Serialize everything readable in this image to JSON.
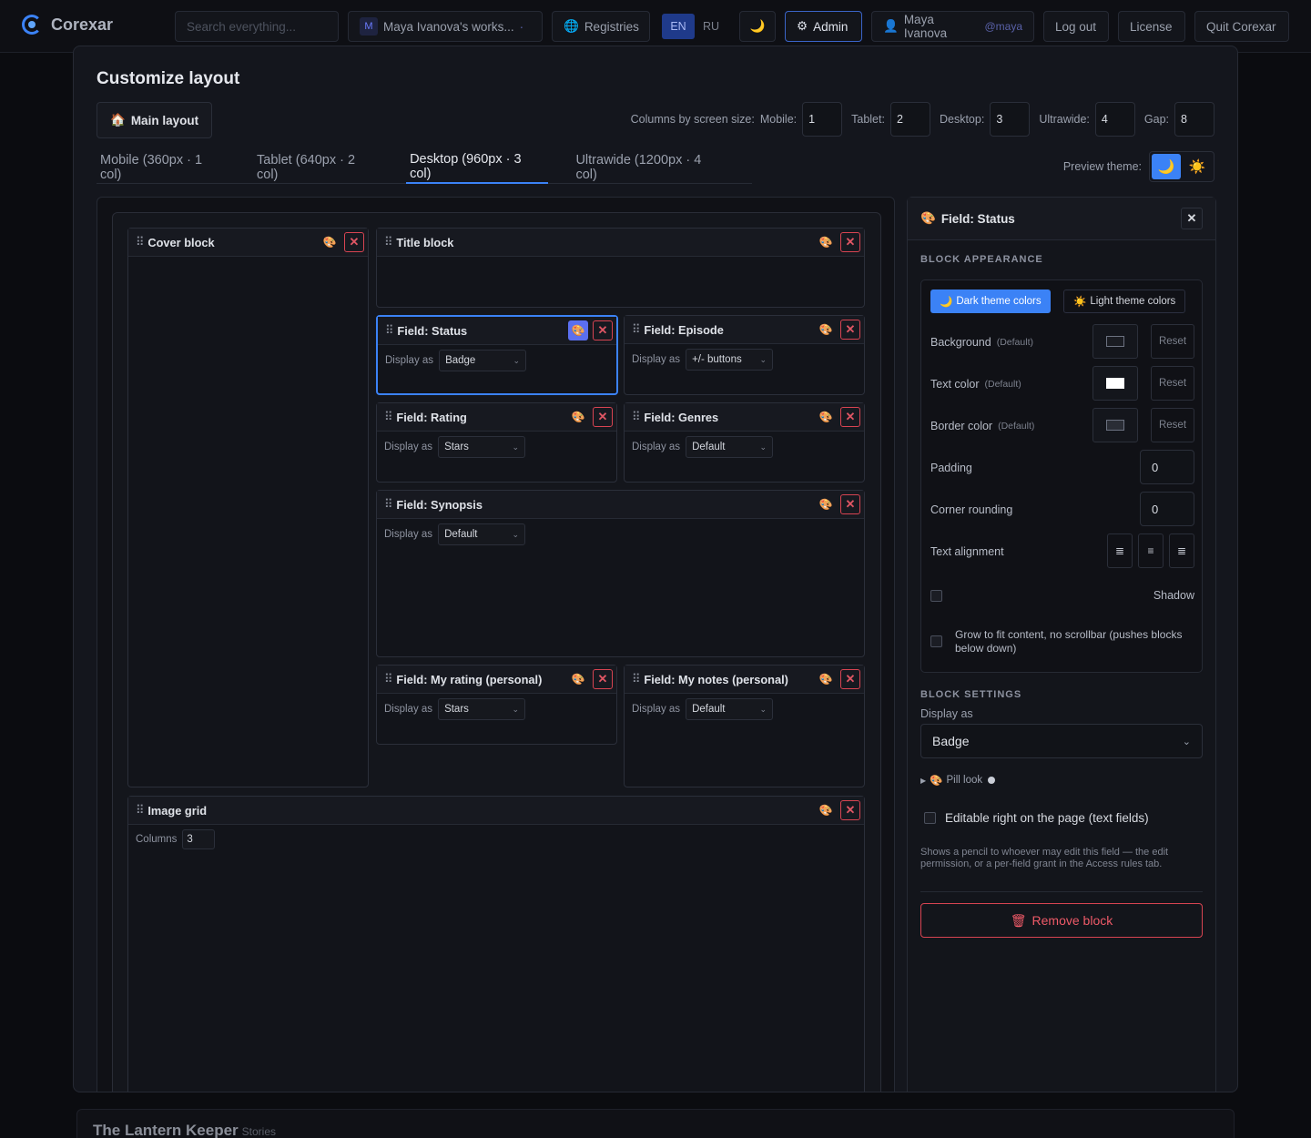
{
  "app": {
    "name": "Corexar",
    "search_placeholder": "Search everything...",
    "workspace_initial": "M",
    "workspace": "Maya Ivanova's works...",
    "workspace_handle": "·",
    "registries": "Registries",
    "languages": [
      "EN",
      "RU"
    ],
    "admin": "Admin",
    "user_name": "Maya Ivanova",
    "user_handle": "@maya",
    "logout": "Log out",
    "license": "License",
    "quit": "Quit Corexar"
  },
  "modal": {
    "title": "Customize layout",
    "layout_button": "Main layout",
    "columns_label": "Columns by screen size:",
    "columns": [
      {
        "label": "Mobile:",
        "value": "1"
      },
      {
        "label": "Tablet:",
        "value": "2"
      },
      {
        "label": "Desktop:",
        "value": "3"
      },
      {
        "label": "Ultrawide:",
        "value": "4"
      },
      {
        "label": "Gap:",
        "value": "8"
      }
    ],
    "tabs": [
      {
        "label": "Mobile (360px · 1 col)",
        "active": false
      },
      {
        "label": "Tablet (640px · 2 col)",
        "active": false
      },
      {
        "label": "Desktop (960px · 3 col)",
        "active": true
      },
      {
        "label": "Ultrawide (1200px · 4 col)",
        "active": false
      }
    ],
    "preview_theme_label": "Preview theme:"
  },
  "blocks": {
    "display_as": "Display as",
    "cover": "Cover block",
    "title": "Title block",
    "status": {
      "name": "Field: Status",
      "display": "Badge"
    },
    "episode": {
      "name": "Field: Episode",
      "display": "+/- buttons"
    },
    "rating": {
      "name": "Field: Rating",
      "display": "Stars"
    },
    "genres": {
      "name": "Field: Genres",
      "display": "Default"
    },
    "synopsis": {
      "name": "Field: Synopsis",
      "display": "Default"
    },
    "my_rating": {
      "name": "Field: My rating (personal)",
      "display": "Stars"
    },
    "my_notes": {
      "name": "Field: My notes (personal)",
      "display": "Default"
    },
    "image_grid": {
      "name": "Image grid",
      "columns_label": "Columns",
      "columns": "3"
    }
  },
  "panel": {
    "title": "Field: Status",
    "appearance_title": "BLOCK APPEARANCE",
    "dark_colors": "Dark theme colors",
    "light_colors": "Light theme colors",
    "background": "Background",
    "text_color": "Text color",
    "border_color": "Border color",
    "default_tag": "(Default)",
    "reset": "Reset",
    "padding_label": "Padding",
    "padding": "0",
    "rounding_label": "Corner rounding",
    "rounding": "0",
    "alignment_label": "Text alignment",
    "shadow_label": "Shadow",
    "grow_label": "Grow to fit content, no scrollbar (pushes blocks below down)",
    "settings_title": "BLOCK SETTINGS",
    "display_as_label": "Display as",
    "display_as": "Badge",
    "pill_look": "Pill look",
    "editable_label": "Editable right on the page (text fields)",
    "editable_help": "Shows a pencil to whoever may edit this field — the edit permission, or a per-field grant in the Access rules tab.",
    "remove": "Remove block"
  },
  "behind": {
    "title": "The Lantern Keeper",
    "subtitle": "Stories"
  },
  "colors": {
    "accent": "#3b82f6",
    "danger": "#d84452",
    "background": "#0b0c10"
  }
}
